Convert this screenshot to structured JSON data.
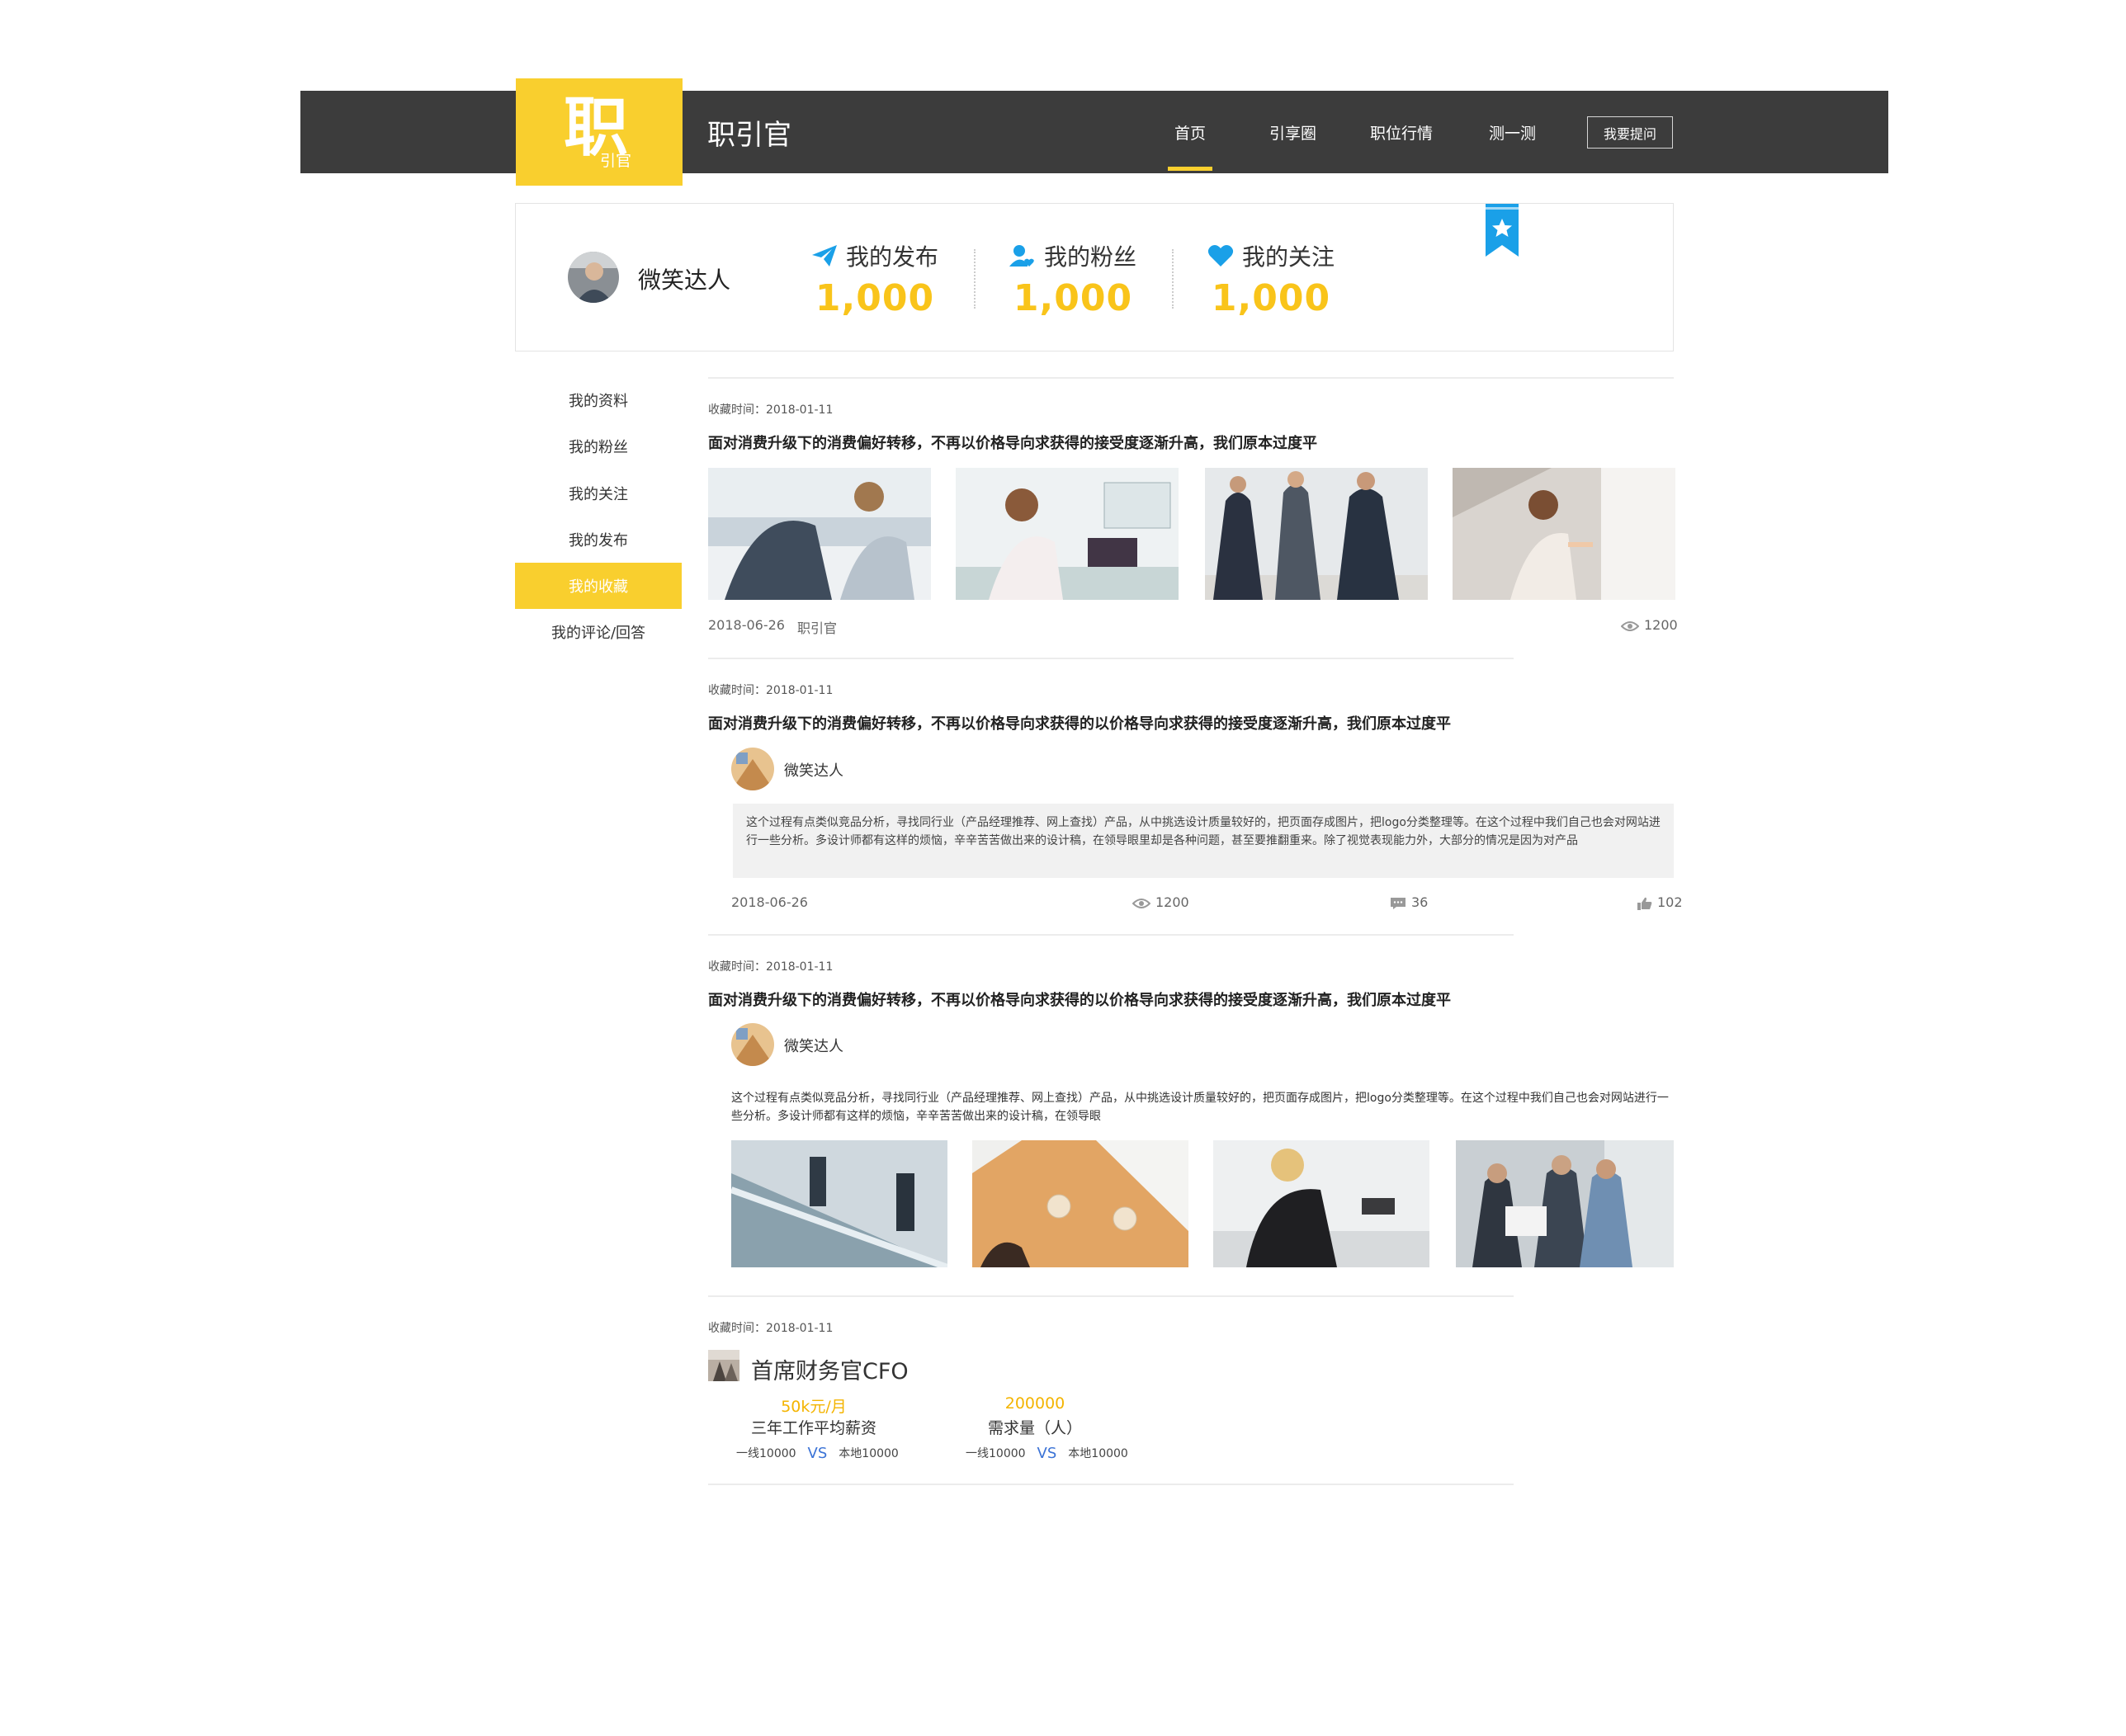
{
  "header": {
    "logo_char": "职",
    "logo_sub": "引官",
    "site_name": "职引官",
    "nav": [
      {
        "label": "首页",
        "active": true
      },
      {
        "label": "引享圈",
        "active": false
      },
      {
        "label": "职位行情",
        "active": false
      },
      {
        "label": "测一测",
        "active": false
      }
    ],
    "ask_button": "我要提问",
    "accent_color": "#f9cf2e",
    "bar_color": "#3c3c3c"
  },
  "profile": {
    "name": "微笑达人",
    "stats": [
      {
        "label": "我的发布",
        "value": "1,000",
        "icon": "paper-plane-icon"
      },
      {
        "label": "我的粉丝",
        "value": "1,000",
        "icon": "user-heart-icon"
      },
      {
        "label": "我的关注",
        "value": "1,000",
        "icon": "heart-icon"
      }
    ],
    "value_color": "#f9c41a",
    "icon_color": "#1aa0e8"
  },
  "sidebar": {
    "items": [
      {
        "label": "我的资料",
        "active": false
      },
      {
        "label": "我的粉丝",
        "active": false
      },
      {
        "label": "我的关注",
        "active": false
      },
      {
        "label": "我的发布",
        "active": false
      },
      {
        "label": "我的收藏",
        "active": true
      },
      {
        "label": "我的评论/回答",
        "active": false
      }
    ]
  },
  "favorites": [
    {
      "collected": "收藏时间：2018-01-11",
      "title": "面对消费升级下的消费偏好转移，不再以价格导向求获得的接受度逐渐升高，我们原本过度平",
      "date": "2018-06-26",
      "source": "职引官",
      "views": "1200"
    },
    {
      "collected": "收藏时间：2018-01-11",
      "title": "面对消费升级下的消费偏好转移，不再以价格导向求获得的以价格导向求获得的接受度逐渐升高，我们原本过度平",
      "author": "微笑达人",
      "quote": "这个过程有点类似竞品分析，寻找同行业（产品经理推荐、网上查找）产品，从中挑选设计质量较好的，把页面存成图片，把logo分类整理等。在这个过程中我们自己也会对网站进行一些分析。多设计师都有这样的烦恼，辛辛苦苦做出来的设计稿，在领导眼里却是各种问题，甚至要推翻重来。除了视觉表现能力外，大部分的情况是因为对产品",
      "date": "2018-06-26",
      "views": "1200",
      "comments": "36",
      "likes": "102"
    },
    {
      "collected": "收藏时间：2018-01-11",
      "title": "面对消费升级下的消费偏好转移，不再以价格导向求获得的以价格导向求获得的接受度逐渐升高，我们原本过度平",
      "author": "微笑达人",
      "desc": "这个过程有点类似竞品分析，寻找同行业（产品经理推荐、网上查找）产品，从中挑选设计质量较好的，把页面存成图片，把logo分类整理等。在这个过程中我们自己也会对网站进行一些分析。多设计师都有这样的烦恼，辛辛苦苦做出来的设计稿，在领导眼"
    },
    {
      "collected": "收藏时间：2018-01-11",
      "job_title": "首席财务官CFO",
      "salary_value": "50k元/月",
      "salary_label": "三年工作平均薪资",
      "salary_left": "一线10000",
      "salary_right": "本地10000",
      "demand_value": "200000",
      "demand_label": "需求量（人）",
      "demand_left": "一线10000",
      "demand_right": "本地10000",
      "vs": "VS"
    }
  ]
}
